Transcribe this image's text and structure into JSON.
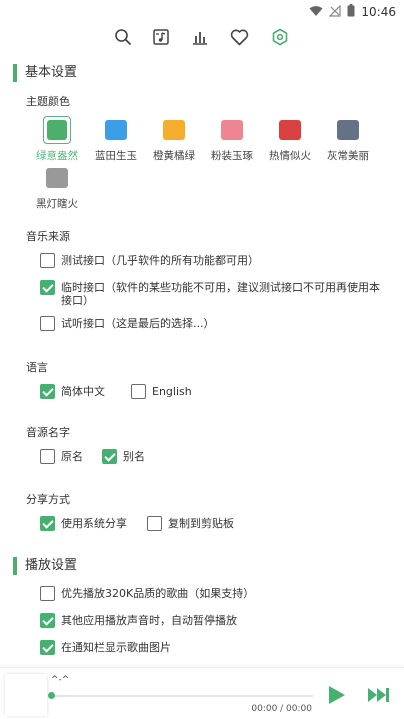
{
  "status_bar": {
    "time": "10:46",
    "icons": [
      "wifi-icon",
      "no-signal-icon",
      "battery-icon"
    ]
  },
  "nav": {
    "icons": [
      "search-icon",
      "music-list-icon",
      "chart-icon",
      "heart-icon",
      "settings-icon"
    ],
    "active": "settings-icon"
  },
  "basic_settings": {
    "title": "基本设置",
    "theme_label": "主题颜色",
    "themes": [
      {
        "name": "绿意盎然",
        "color": "#4caf6e",
        "active": true
      },
      {
        "name": "蓝田生玉",
        "color": "#3a9fe4"
      },
      {
        "name": "橙黄橘绿",
        "color": "#f5ad2d"
      },
      {
        "name": "粉装玉琢",
        "color": "#ef8593"
      },
      {
        "name": "热情似火",
        "color": "#d94141"
      },
      {
        "name": "灰常美丽",
        "color": "#657285"
      },
      {
        "name": "黑灯瞎火",
        "color": "#999999"
      }
    ],
    "source_label": "音乐来源",
    "sources": [
      {
        "text": "测试接口（几乎软件的所有功能都可用）",
        "checked": false
      },
      {
        "text": "临时接口（软件的某些功能不可用，建议测试接口不可用再使用本接口）",
        "checked": true
      },
      {
        "text": "试听接口（这是最后的选择...）",
        "checked": false
      }
    ],
    "language_label": "语言",
    "languages": [
      {
        "text": "简体中文",
        "checked": true
      },
      {
        "text": "English",
        "checked": false
      }
    ],
    "source_name_label": "音源名字",
    "source_names": [
      {
        "text": "原名",
        "checked": false
      },
      {
        "text": "别名",
        "checked": true
      }
    ],
    "share_label": "分享方式",
    "share_options": [
      {
        "text": "使用系统分享",
        "checked": true
      },
      {
        "text": "复制到剪贴板",
        "checked": false
      }
    ]
  },
  "playback_settings": {
    "title": "播放设置",
    "options": [
      {
        "text": "优先播放320K品质的歌曲（如果支持）",
        "checked": false
      },
      {
        "text": "其他应用播放声音时，自动暂停播放",
        "checked": true
      },
      {
        "text": "在通知栏显示歌曲图片",
        "checked": true
      }
    ]
  },
  "player": {
    "title": "^-^",
    "time": "00:00 / 00:00",
    "progress": 0
  },
  "colors": {
    "accent": "#46b073"
  }
}
